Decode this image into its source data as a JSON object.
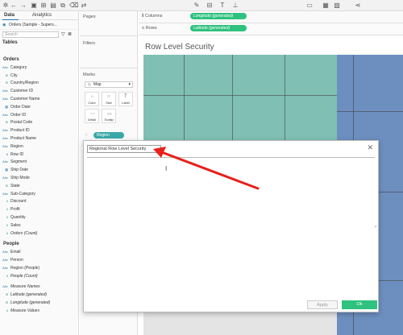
{
  "toolbar": {
    "icons": [
      "tableau-logo-icon",
      "undo-icon",
      "redo-icon",
      "save-icon",
      "new-datasource-icon",
      "pause-icon",
      "new-sheet-icon",
      "duplicate-icon",
      "clear-icon",
      "swap-icon",
      "sort-asc-icon",
      "sort-desc-icon",
      "highlight-icon",
      "group-icon",
      "label-icon",
      "fix-axes-icon",
      "fit-icon",
      "show-cards-icon",
      "tooltip-icon",
      "share-icon"
    ]
  },
  "datapane": {
    "tab_data": "Data",
    "tab_analytics": "Analytics",
    "datasource": "Orders (Sample - Supers...",
    "search_placeholder": "Search",
    "tables_title": "Tables",
    "orders_group": "Orders",
    "orders_fields": [
      {
        "label": "Category",
        "type": "Abc",
        "kind": "dim"
      },
      {
        "label": "City",
        "type": "⊕",
        "kind": "geo"
      },
      {
        "label": "Country/Region",
        "type": "⊕",
        "kind": "geo"
      },
      {
        "label": "Customer ID",
        "type": "Abc",
        "kind": "dim"
      },
      {
        "label": "Customer Name",
        "type": "Abc",
        "kind": "dim"
      },
      {
        "label": "Order Date",
        "type": "▦",
        "kind": "dim"
      },
      {
        "label": "Order ID",
        "type": "Abc",
        "kind": "dim"
      },
      {
        "label": "Postal Code",
        "type": "⊕",
        "kind": "geo"
      },
      {
        "label": "Product ID",
        "type": "Abc",
        "kind": "dim"
      },
      {
        "label": "Product Name",
        "type": "Abc",
        "kind": "dim"
      },
      {
        "label": "Region",
        "type": "Abc",
        "kind": "dim"
      },
      {
        "label": "Row ID",
        "type": "#",
        "kind": "dim"
      },
      {
        "label": "Segment",
        "type": "Abc",
        "kind": "dim"
      },
      {
        "label": "Ship Date",
        "type": "▦",
        "kind": "dim"
      },
      {
        "label": "Ship Mode",
        "type": "Abc",
        "kind": "dim"
      },
      {
        "label": "State",
        "type": "⊕",
        "kind": "geo"
      },
      {
        "label": "Sub-Category",
        "type": "Abc",
        "kind": "dim"
      },
      {
        "label": "Discount",
        "type": "#",
        "kind": "meas"
      },
      {
        "label": "Profit",
        "type": "#",
        "kind": "meas"
      },
      {
        "label": "Quantity",
        "type": "#",
        "kind": "meas"
      },
      {
        "label": "Sales",
        "type": "#",
        "kind": "meas"
      },
      {
        "label": "Orders (Count)",
        "type": "#",
        "kind": "meas",
        "italic": true
      }
    ],
    "people_group": "People",
    "people_fields": [
      {
        "label": "Email",
        "type": "Abc",
        "kind": "dim"
      },
      {
        "label": "Person",
        "type": "Abc",
        "kind": "dim"
      },
      {
        "label": "Region (People)",
        "type": "Abc",
        "kind": "dim"
      },
      {
        "label": "People (Count)",
        "type": "#",
        "kind": "meas",
        "italic": true
      }
    ],
    "extra_fields": [
      {
        "label": "Measure Names",
        "type": "Abc",
        "kind": "dim",
        "italic": true
      },
      {
        "label": "Latitude (generated)",
        "type": "⊕",
        "kind": "meas",
        "italic": true
      },
      {
        "label": "Longitude (generated)",
        "type": "⊕",
        "kind": "meas",
        "italic": true
      },
      {
        "label": "Measure Values",
        "type": "#",
        "kind": "meas",
        "italic": true
      }
    ]
  },
  "shelfpane": {
    "pages": "Pages",
    "filters": "Filters",
    "marks": "Marks",
    "mark_type": "Map",
    "color": "Color",
    "size": "Size",
    "label": "Label",
    "detail": "Detail",
    "tooltip": "Tooltip",
    "region_pill": "Region"
  },
  "shelves": {
    "columns_label": "Columns",
    "rows_label": "Rows",
    "columns_pill": "Longitude (generated)",
    "rows_pill": "Latitude (generated)"
  },
  "viz": {
    "title": "Row Level Security"
  },
  "dialog": {
    "name_value": "Regional Row Level Security",
    "apply": "Apply",
    "ok": "Ok"
  },
  "colors": {
    "west_region": "#7fbfb4",
    "east_region": "#6d8fbf",
    "pill_green": "#2ec27e",
    "annotation_arrow": "#e8201a"
  }
}
